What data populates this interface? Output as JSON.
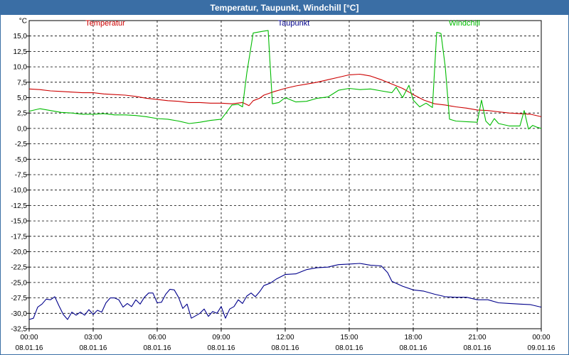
{
  "window": {
    "title": "Temperatur, Taupunkt, Windchill [°C]"
  },
  "chart_data": {
    "type": "line",
    "title": "Temperatur, Taupunkt, Windchill [°C]",
    "y_unit_label": "°C",
    "ylim": [
      -32.5,
      17.5
    ],
    "yticks": [
      "15,0",
      "12,5",
      "10,0",
      "7,5",
      "5,0",
      "2,5",
      "0,0",
      "-2,5",
      "-5,0",
      "-7,5",
      "-10,0",
      "-12,5",
      "-15,0",
      "-17,5",
      "-20,0",
      "-22,5",
      "-25,0",
      "-27,5",
      "-30,0",
      "-32,5"
    ],
    "ytick_values": [
      15,
      12.5,
      10,
      7.5,
      5,
      2.5,
      0,
      -2.5,
      -5,
      -7.5,
      -10,
      -12.5,
      -15,
      -17.5,
      -20,
      -22.5,
      -25,
      -27.5,
      -30,
      -32.5
    ],
    "xlim": [
      0,
      24
    ],
    "xticks": [
      {
        "h": 0,
        "time": "00:00",
        "date": "08.01.16"
      },
      {
        "h": 3,
        "time": "03:00",
        "date": "08.01.16"
      },
      {
        "h": 6,
        "time": "06:00",
        "date": "08.01.16"
      },
      {
        "h": 9,
        "time": "09:00",
        "date": "08.01.16"
      },
      {
        "h": 12,
        "time": "12:00",
        "date": "08.01.16"
      },
      {
        "h": 15,
        "time": "15:00",
        "date": "08.01.16"
      },
      {
        "h": 18,
        "time": "18:00",
        "date": "08.01.16"
      },
      {
        "h": 21,
        "time": "21:00",
        "date": "08.01.16"
      },
      {
        "h": 24,
        "time": "00:00",
        "date": "09.01.16"
      }
    ],
    "grid": true,
    "series": [
      {
        "name": "Temperatur",
        "color": "#cc0000",
        "x": [
          0,
          0.5,
          1,
          1.5,
          2,
          2.5,
          3,
          3.5,
          4,
          4.5,
          5,
          5.5,
          6,
          6.5,
          7,
          7.5,
          8,
          8.5,
          9,
          9.5,
          10,
          10.3,
          10.5,
          10.8,
          11,
          11.5,
          12,
          12.5,
          13,
          13.5,
          14,
          14.5,
          15,
          15.5,
          16,
          16.5,
          17,
          17.5,
          18,
          18.5,
          19,
          19.5,
          20,
          20.5,
          21,
          21.5,
          22,
          22.5,
          23,
          23.5,
          24
        ],
        "values": [
          6.4,
          6.3,
          6.1,
          6,
          5.9,
          5.8,
          5.8,
          5.6,
          5.5,
          5.4,
          5.2,
          4.9,
          4.7,
          4.5,
          4.4,
          4.2,
          4.2,
          4.1,
          4.1,
          4,
          4.2,
          3.7,
          4.5,
          4.9,
          5.4,
          6,
          6.5,
          6.9,
          7.2,
          7.5,
          7.9,
          8.3,
          8.7,
          8.8,
          8.5,
          7.9,
          7.2,
          6.5,
          5.5,
          4.6,
          4,
          3.8,
          3.5,
          3.3,
          3,
          2.9,
          2.7,
          2.5,
          2.4,
          2.3,
          1.9
        ]
      },
      {
        "name": "Taupunkt",
        "color": "#00008b",
        "x": [
          0,
          0.2,
          0.4,
          0.6,
          0.8,
          1,
          1.2,
          1.4,
          1.6,
          1.8,
          2,
          2.2,
          2.4,
          2.6,
          2.8,
          3,
          3.2,
          3.4,
          3.6,
          3.8,
          4,
          4.2,
          4.4,
          4.6,
          4.8,
          5,
          5.2,
          5.4,
          5.6,
          5.8,
          6,
          6.2,
          6.4,
          6.6,
          6.8,
          7,
          7.2,
          7.4,
          7.6,
          7.8,
          8,
          8.2,
          8.4,
          8.6,
          8.8,
          9,
          9.2,
          9.4,
          9.6,
          9.8,
          10,
          10.2,
          10.4,
          10.6,
          10.8,
          11,
          11.3,
          11.6,
          12,
          12.5,
          13,
          13.5,
          14,
          14.5,
          15,
          15.5,
          16,
          16.5,
          16.8,
          17,
          17.5,
          18,
          18.5,
          19,
          19.5,
          20,
          20.5,
          21,
          21.5,
          22,
          22.5,
          23,
          23.5,
          24
        ],
        "values": [
          -31,
          -30.8,
          -29,
          -28.5,
          -27.7,
          -27.8,
          -27.3,
          -28.8,
          -30.2,
          -31,
          -29.8,
          -30.3,
          -29.8,
          -30.3,
          -29.4,
          -30.2,
          -29.5,
          -29.8,
          -28.3,
          -27.5,
          -27.5,
          -27.8,
          -29,
          -28.4,
          -28.9,
          -27.8,
          -28.5,
          -27.4,
          -26.7,
          -26.7,
          -28.3,
          -28.2,
          -26.9,
          -26.1,
          -26.2,
          -27.4,
          -29.2,
          -28.5,
          -30.8,
          -30.4,
          -30,
          -29.3,
          -30.5,
          -29.7,
          -30,
          -28.9,
          -30.8,
          -29.3,
          -28.9,
          -27.8,
          -28.4,
          -27.2,
          -26.7,
          -27.3,
          -26.5,
          -25.5,
          -25.1,
          -24.4,
          -23.7,
          -23.6,
          -22.9,
          -22.6,
          -22.5,
          -22.1,
          -22,
          -21.9,
          -22.2,
          -22.3,
          -23.4,
          -24.8,
          -25.6,
          -26.2,
          -26.4,
          -26.9,
          -27.3,
          -27.4,
          -27.4,
          -27.8,
          -27.8,
          -28.3,
          -28.4,
          -28.5,
          -28.6,
          -29
        ]
      },
      {
        "name": "Windchill",
        "color": "#00bb00",
        "x": [
          0,
          0.5,
          1,
          1.5,
          2,
          2.5,
          3,
          3.5,
          4,
          4.5,
          5,
          5.5,
          6,
          6.5,
          7,
          7.5,
          8,
          8.5,
          9,
          9.2,
          9.5,
          9.8,
          10,
          10.2,
          10.5,
          11,
          11.2,
          11.4,
          11.7,
          12,
          12.5,
          13,
          13.5,
          14,
          14.5,
          15,
          15.5,
          16,
          16.5,
          17,
          17.2,
          17.5,
          17.8,
          18,
          18.3,
          18.6,
          18.9,
          19.1,
          19.3,
          19.5,
          19.7,
          20,
          20.5,
          21,
          21.2,
          21.4,
          21.6,
          21.8,
          22,
          22.5,
          23,
          23.2,
          23.4,
          23.6,
          23.8,
          24
        ],
        "values": [
          2.8,
          3.2,
          2.9,
          2.6,
          2.5,
          2.3,
          2.3,
          2.4,
          2.2,
          2.2,
          2.1,
          1.9,
          1.6,
          1.5,
          1.2,
          0.8,
          1,
          1.3,
          1.5,
          2.4,
          3.8,
          3.9,
          3.5,
          9,
          15.5,
          15.8,
          15.9,
          4,
          4.2,
          5,
          4.3,
          4.4,
          4.9,
          5.1,
          6.2,
          6.5,
          6.3,
          6.4,
          6.1,
          5.8,
          6.7,
          5,
          7,
          4.6,
          3.5,
          4.1,
          3.4,
          15.6,
          15.4,
          10,
          1.5,
          1.2,
          1.1,
          1,
          4.6,
          1.2,
          0.5,
          1.6,
          0.8,
          0.4,
          0.4,
          2.9,
          -0.1,
          0.5,
          0.2,
          0
        ]
      }
    ]
  }
}
